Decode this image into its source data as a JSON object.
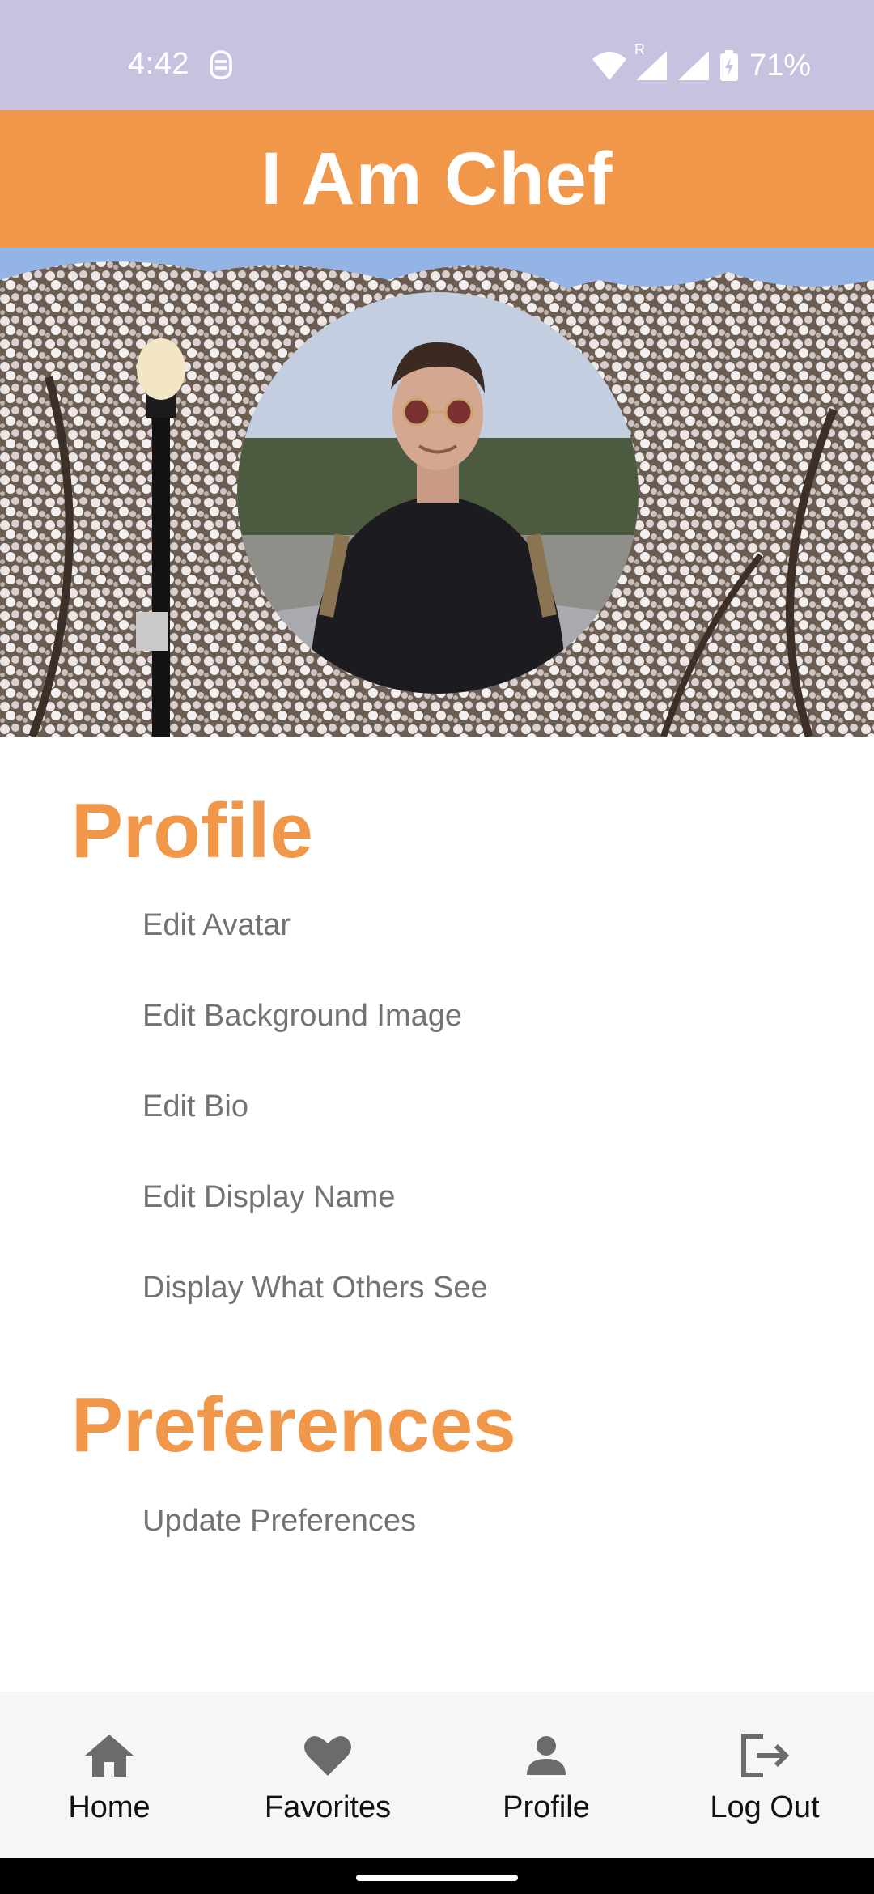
{
  "status_bar": {
    "time": "4:42",
    "battery": "71%",
    "signal_label": "R",
    "background": "#c8c1e0"
  },
  "header": {
    "title": "I Am Chef",
    "background": "#f0974a"
  },
  "sections": [
    {
      "title": "Profile",
      "items": [
        {
          "label": "Edit Avatar"
        },
        {
          "label": "Edit Background Image"
        },
        {
          "label": "Edit Bio"
        },
        {
          "label": "Edit Display Name"
        },
        {
          "label": "Display What Others See"
        }
      ]
    },
    {
      "title": "Preferences",
      "items": [
        {
          "label": "Update Preferences"
        }
      ]
    }
  ],
  "bottom_nav": {
    "items": [
      {
        "label": "Home",
        "icon": "home-icon"
      },
      {
        "label": "Favorites",
        "icon": "heart-icon"
      },
      {
        "label": "Profile",
        "icon": "person-icon"
      },
      {
        "label": "Log Out",
        "icon": "logout-icon"
      }
    ]
  },
  "colors": {
    "accent": "#f0974a",
    "menu_text": "#737373"
  }
}
